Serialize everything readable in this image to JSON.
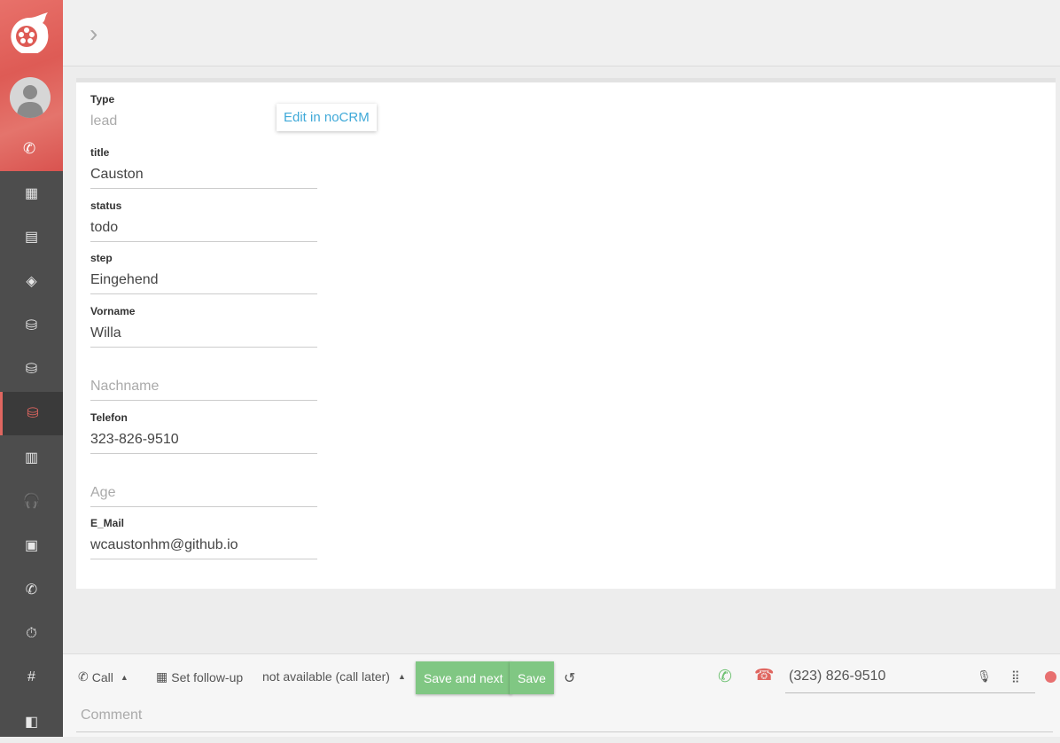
{
  "colors": {
    "brand": "#de5b55",
    "sidebar": "#4d4d4d",
    "save": "#80c783",
    "hangup": "#e06660",
    "call": "#6cc070",
    "link": "#3fa9d8"
  },
  "sidebar": {
    "items": [
      {
        "icon": "dashboard-icon",
        "glyph": "▦"
      },
      {
        "icon": "archive-icon",
        "glyph": "▤"
      },
      {
        "icon": "layers-icon",
        "glyph": "◈"
      },
      {
        "icon": "database-import-icon",
        "glyph": "⛁"
      },
      {
        "icon": "database-export-icon",
        "glyph": "⛁"
      },
      {
        "icon": "database-icon",
        "glyph": "⛁",
        "active": true
      },
      {
        "icon": "bar-chart-icon",
        "glyph": "▥"
      },
      {
        "icon": "headset-icon",
        "glyph": "🎧"
      },
      {
        "icon": "message-chart-icon",
        "glyph": "▣"
      },
      {
        "icon": "phone-icon",
        "glyph": "✆"
      },
      {
        "icon": "stopwatch-icon",
        "glyph": "⏱"
      },
      {
        "icon": "phone-hash-icon",
        "glyph": "#"
      },
      {
        "icon": "share-icon",
        "glyph": "◧"
      }
    ]
  },
  "record": {
    "edit_label": "Edit in noCRM",
    "fields": [
      {
        "label": "Type",
        "value": "lead",
        "readonly": true
      },
      {
        "label": "title",
        "value": "Causton"
      },
      {
        "label": "status",
        "value": "todo"
      },
      {
        "label": "step",
        "value": "Eingehend"
      },
      {
        "label": "Vorname",
        "value": "Willa"
      },
      {
        "label": "",
        "placeholder": "Nachname"
      },
      {
        "label": "Telefon",
        "value": "323-826-9510"
      },
      {
        "label": "",
        "placeholder": "Age"
      },
      {
        "label": "E_Mail",
        "value": "wcaustonhm@github.io"
      }
    ]
  },
  "toolbar": {
    "call": "Call",
    "followup": "Set follow-up",
    "status": "not available (call later)",
    "save_next": "Save and next",
    "save": "Save",
    "phone": "(323) 826-9510",
    "comment_placeholder": "Comment"
  }
}
